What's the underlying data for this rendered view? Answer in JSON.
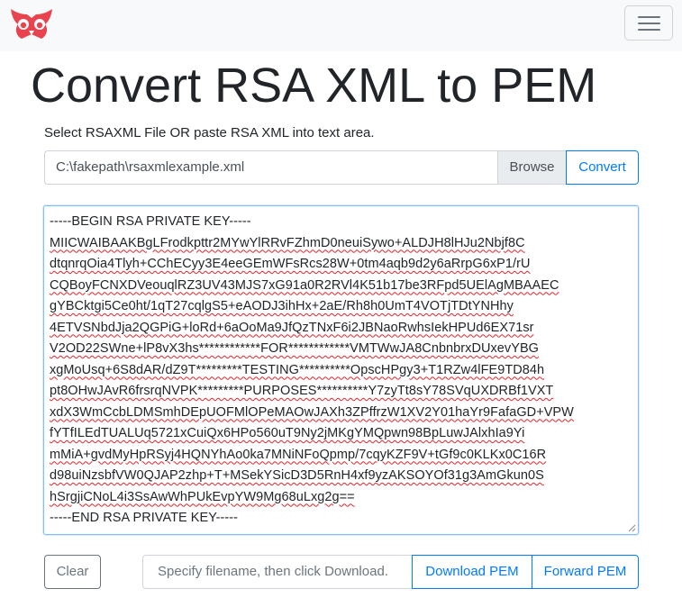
{
  "navbar": {
    "logo_icon": "owl-logo-icon",
    "logo_color": "#e8434f",
    "toggler_icon": "hamburger-menu-icon"
  },
  "header": {
    "title": "Convert RSA XML to PEM"
  },
  "instructions": "Select RSAXML File OR paste RSA XML into text area.",
  "file_picker": {
    "value": "C:\\fakepath\\rsaxmlexample.xml",
    "browse_label": "Browse",
    "convert_label": "Convert"
  },
  "editor": {
    "lines": [
      "-----BEGIN RSA PRIVATE KEY-----",
      "MIICWAIBAAKBgLFrodkpttr2MYwYlRRvFZhmD0neuiSywo+ALDJH8lHJu2Nbjf8C",
      "dtqnrqOia4Tlyh+CChECyy3E4eeGEmWFsRcs28W+0tm4aqb9d2y6aRrpG6xP1/rU",
      "CQBoyFCNXDVeouqlRZ3UV43MJS7xG91a0R2RVl4K51b17be3RFpd5UElAgMBAAEC",
      "gYBCktgi5Ce0ht/1qT27cqlgS5+eAODJ3ihHx+2aE/Rh8h0UmT4VOTjTDtYNHhy",
      "4ETVSNbdJja2QGPiG+loRd+6aOoMa9JfQzTNxF6i2JBNaoRwhsIekHPUd6EX71sr",
      "V2OD22SWne+lP8vX3hs************FOR************VMTWwJA8CnbnbrxDUxevYBG",
      "xgMoUsq+6S8dAR/dZ9T*********TESTING**********OpscHPgy3+T1RZw4lFE9TD84h",
      "pt8OHwJAvR6frsrqNVPK*********PURPOSES**********Y7zyTt8sY78SVqUXDRBf1VXT",
      "xdX3WmCcbLDMSmhDEpUOFMlOPeMAOwJAXh3ZPffrzW1XV2Y01haYr9FafaGD+VPW",
      "fYTfILEdTUALUq5721xCuiQx6HPo560uT9Ny2jMKgYMQpwn98BpLuwJAlxhIa9Yi",
      "mMiA+gvdMyHpRSyj4HQNYhAo0ka7MNiNFoQpmp/7cqyKZF9V+tGf9c0KLKx0C16R",
      "d98uiNzsbfVW0QJAP2zhp+T+MSekYSicD3D5RnH4xf9yzAKSOYOf31g3AmGkun0S",
      "hSrgjiCNoL4i3SsAwWhPUkEvpYW9Mg68uLxg2g==",
      "-----END RSA PRIVATE KEY-----"
    ]
  },
  "actions": {
    "clear_label": "Clear",
    "filename_placeholder": "Specify filename, then click Download.",
    "download_label": "Download PEM",
    "forward_label": "Forward PEM"
  },
  "colors": {
    "primary": "#007bff",
    "secondary": "#6c757d",
    "navbar_bg": "#f8f9fa",
    "spellcheck": "#e0252b"
  }
}
